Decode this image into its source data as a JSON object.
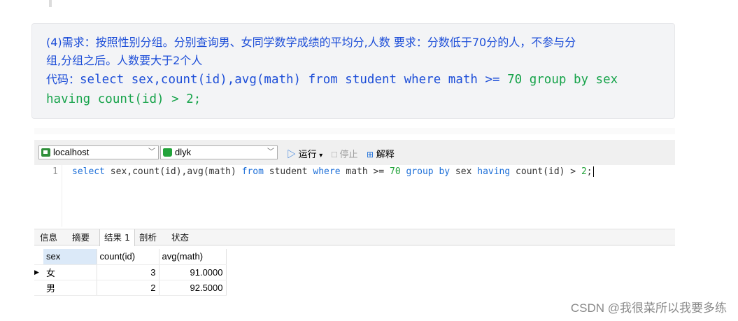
{
  "note": {
    "line1": "(4)需求：按照性别分组。分别查询男、女同学数学成绩的平均分,人数 要求：分数低于70分的人，不参与分",
    "line2": "组,分组之后。人数要大于2个人",
    "code_prefix": "代码：",
    "code_part1": "select sex,count(id),avg(math) from student where math >=",
    "code_num": "70",
    "code_part2": "group by sex",
    "code_line2": "having count(id) > 2;"
  },
  "toolbar": {
    "connection": "localhost",
    "database": "dlyk",
    "run_label": "运行",
    "run_dropdown": "▾",
    "stop_label": "停止",
    "explain_label": "解释"
  },
  "editor": {
    "line_number": "1",
    "sql_1": "select",
    "sql_2": " sex,count(id),avg(math) ",
    "sql_3": "from",
    "sql_4": " student ",
    "sql_5": "where",
    "sql_6": " math >= ",
    "sql_7": "70",
    "sql_8": " ",
    "sql_9": "group by",
    "sql_10": " sex ",
    "sql_11": "having",
    "sql_12": " count(id) > ",
    "sql_13": "2",
    "sql_14": ";"
  },
  "tabs": [
    {
      "label": "信息"
    },
    {
      "label": "摘要"
    },
    {
      "label": "结果 1"
    },
    {
      "label": "剖析"
    },
    {
      "label": "状态"
    }
  ],
  "result": {
    "columns": [
      "sex",
      "count(id)",
      "avg(math)"
    ],
    "rows": [
      [
        "女",
        "3",
        "91.0000"
      ],
      [
        "男",
        "2",
        "92.5000"
      ]
    ]
  },
  "watermark": "CSDN @我很菜所以我要多练"
}
